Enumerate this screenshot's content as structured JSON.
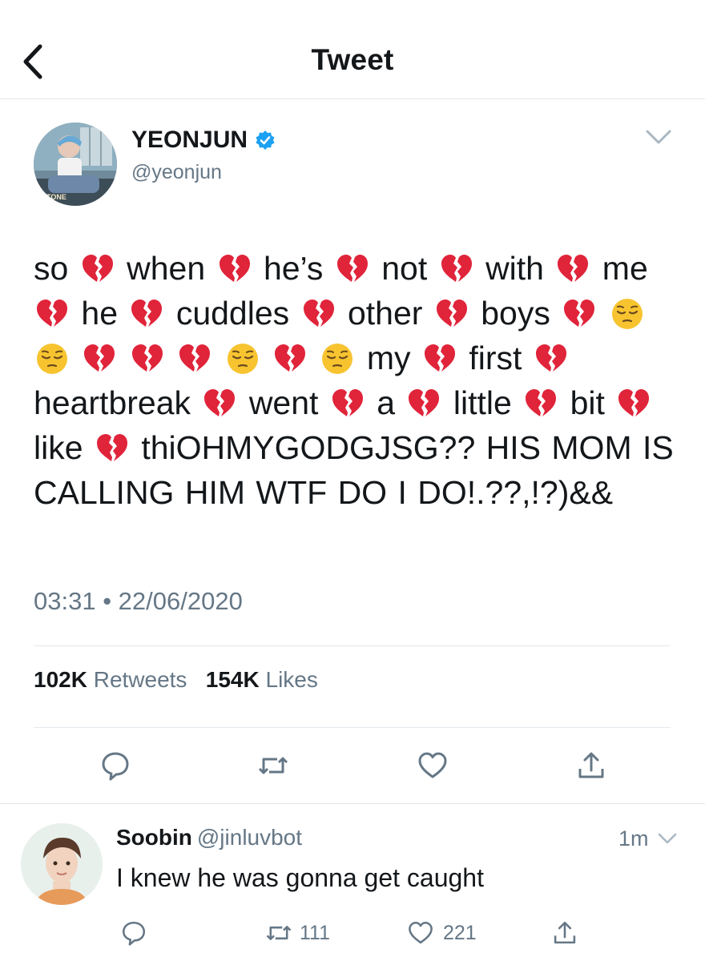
{
  "header": {
    "title": "Tweet",
    "back_icon": "chevron-left-icon"
  },
  "tweet": {
    "author_name": "YEONJUN",
    "author_handle": "@yeonjun",
    "verified": true,
    "avatar_overlay_text": "STONE",
    "segments": [
      {
        "type": "text",
        "value": "so"
      },
      {
        "type": "emoji",
        "value": "broken-heart"
      },
      {
        "type": "text",
        "value": "when"
      },
      {
        "type": "emoji",
        "value": "broken-heart"
      },
      {
        "type": "text",
        "value": "he’s"
      },
      {
        "type": "emoji",
        "value": "broken-heart"
      },
      {
        "type": "text",
        "value": "not"
      },
      {
        "type": "emoji",
        "value": "broken-heart"
      },
      {
        "type": "text",
        "value": "with"
      },
      {
        "type": "emoji",
        "value": "broken-heart"
      },
      {
        "type": "text",
        "value": "me"
      },
      {
        "type": "emoji",
        "value": "broken-heart"
      },
      {
        "type": "text",
        "value": "he"
      },
      {
        "type": "emoji",
        "value": "broken-heart"
      },
      {
        "type": "text",
        "value": "cuddles"
      },
      {
        "type": "emoji",
        "value": "broken-heart"
      },
      {
        "type": "text",
        "value": "other"
      },
      {
        "type": "emoji",
        "value": "broken-heart"
      },
      {
        "type": "text",
        "value": "boys"
      },
      {
        "type": "emoji",
        "value": "broken-heart"
      },
      {
        "type": "emoji",
        "value": "pensive"
      },
      {
        "type": "emoji",
        "value": "pensive"
      },
      {
        "type": "emoji",
        "value": "broken-heart"
      },
      {
        "type": "emoji",
        "value": "broken-heart"
      },
      {
        "type": "emoji",
        "value": "broken-heart"
      },
      {
        "type": "emoji",
        "value": "pensive"
      },
      {
        "type": "emoji",
        "value": "broken-heart"
      },
      {
        "type": "emoji",
        "value": "pensive"
      },
      {
        "type": "text",
        "value": "my"
      },
      {
        "type": "emoji",
        "value": "broken-heart"
      },
      {
        "type": "text",
        "value": "first"
      },
      {
        "type": "emoji",
        "value": "broken-heart"
      },
      {
        "type": "text",
        "value": "heartbreak"
      },
      {
        "type": "emoji",
        "value": "broken-heart"
      },
      {
        "type": "text",
        "value": "went"
      },
      {
        "type": "emoji",
        "value": "broken-heart"
      },
      {
        "type": "text",
        "value": "a"
      },
      {
        "type": "emoji",
        "value": "broken-heart"
      },
      {
        "type": "text",
        "value": "little"
      },
      {
        "type": "emoji",
        "value": "broken-heart"
      },
      {
        "type": "text",
        "value": "bit"
      },
      {
        "type": "emoji",
        "value": "broken-heart"
      },
      {
        "type": "text",
        "value": "like"
      },
      {
        "type": "emoji",
        "value": "broken-heart"
      },
      {
        "type": "text",
        "value": "thiOHMYGODGJSG?? HIS MOM IS CALLING HIM WTF DO I DO!.??,!?)&&"
      }
    ],
    "time": "03:31",
    "date": "22/06/2020",
    "retweets_count": "102K",
    "retweets_label": "Retweets",
    "likes_count": "154K",
    "likes_label": "Likes"
  },
  "reply": {
    "name": "Soobin",
    "handle": "@jinluvbot",
    "time": "1m",
    "text": "I knew he was gonna get caught",
    "retweets": "111",
    "likes": "221"
  },
  "colors": {
    "text": "#14171a",
    "secondary": "#657786",
    "divider": "#e1e8ed",
    "verified": "#1da1f2",
    "broken_heart": "#e0243a",
    "pensive": "#f7c430"
  }
}
